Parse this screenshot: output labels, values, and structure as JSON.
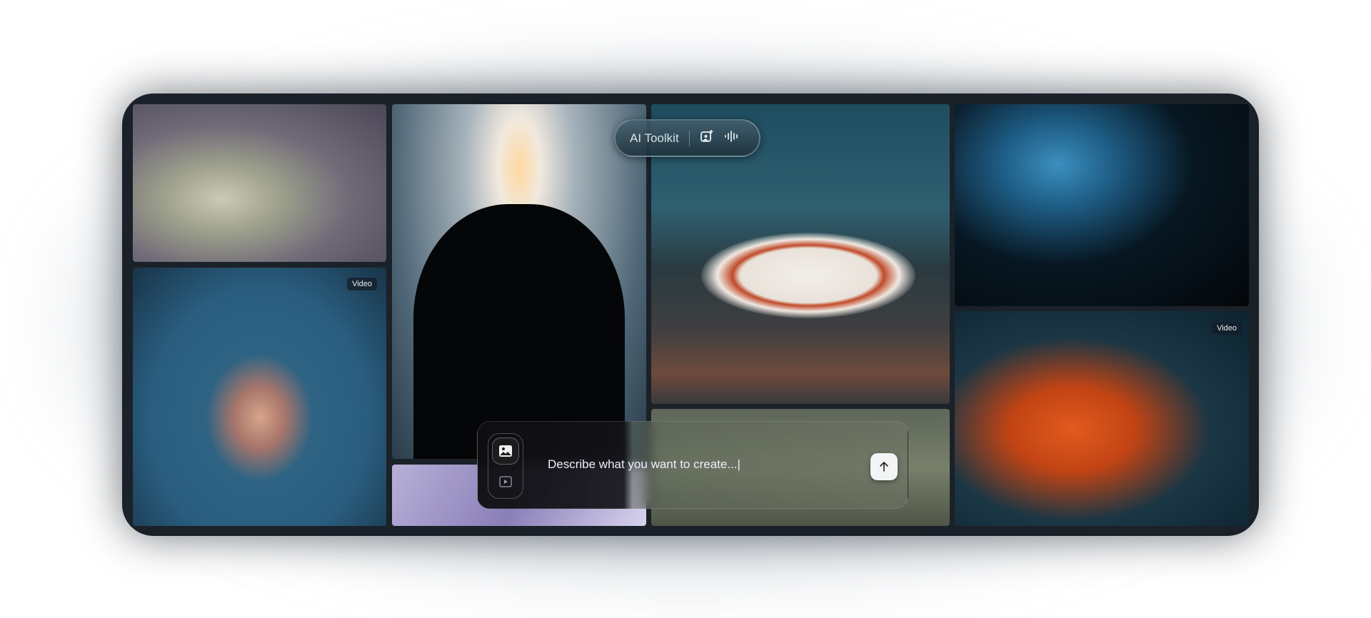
{
  "toolkit": {
    "label": "AI Toolkit",
    "icons": [
      "image-sparkle-icon",
      "audio-waveform-icon"
    ]
  },
  "gallery": {
    "badges": {
      "video1": "Video",
      "video2": "Video"
    }
  },
  "prompt": {
    "placeholder": "Describe what you want to create...|",
    "modes": [
      "image-mode",
      "video-mode"
    ],
    "send_icon": "arrow-up-icon"
  }
}
